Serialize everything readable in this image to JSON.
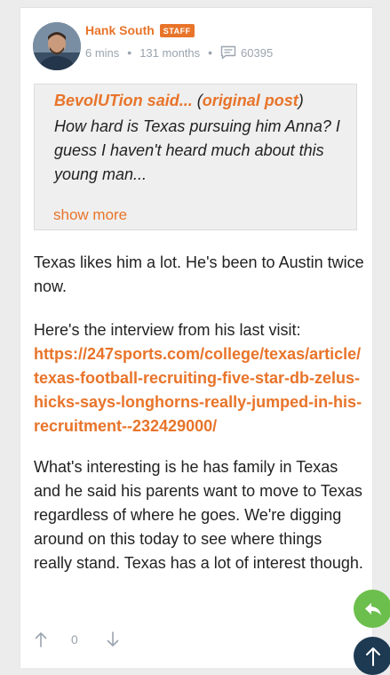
{
  "author": {
    "name": "Hank South",
    "badge": "STAFF"
  },
  "meta": {
    "time": "6 mins",
    "tenure": "131 months",
    "post_count": "60395"
  },
  "quote": {
    "user": "BevolUTion said...",
    "open_paren": " (",
    "link_label": "original post",
    "close_paren": ")",
    "text": "How hard is Texas pursuing him Anna? I guess I haven't heard much about this young man...",
    "show_more": "show more"
  },
  "body": {
    "p1": "Texas likes him a lot. He's been to Austin twice now.",
    "p2": "Here's the interview from his last visit:",
    "link": "https://247sports.com/college/texas/article/texas-football-recruiting-five-star-db-zelus-hicks-says-longhorns-really-jumped-in-his-recruitment--232429000/",
    "p3": "What's interesting is he has family in Texas and he said his parents want to move to Texas regardless of where he goes. We're digging around on this today to see where things really stand. Texas has a lot of interest though."
  },
  "votes": {
    "count": "0"
  },
  "icons": {
    "comment": "comment-bubble-icon",
    "up": "arrow-up-icon",
    "down": "arrow-down-icon",
    "reply": "reply-arrow-icon",
    "top": "scroll-top-icon"
  },
  "colors": {
    "accent": "#e8742a",
    "reply": "#6cbf4c",
    "scroll_top": "#1d3a52",
    "muted": "#9aa4ae",
    "quote_bg": "#efefef"
  }
}
